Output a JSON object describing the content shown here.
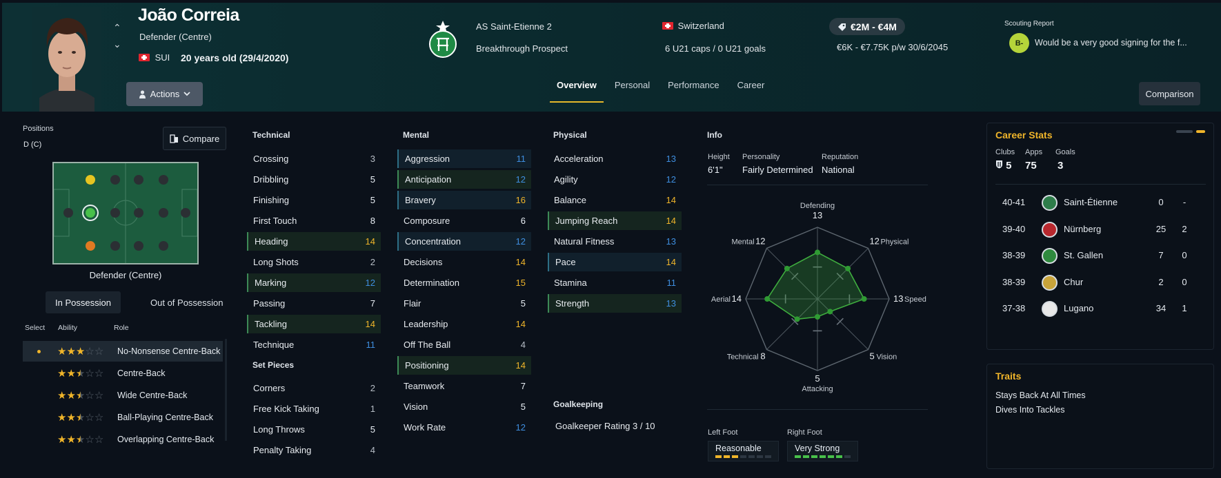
{
  "header": {
    "name": "João Correia",
    "position": "Defender (Centre)",
    "nationality_code": "SUI",
    "age": "20 years old (29/4/2020)",
    "actions_label": "Actions",
    "club": "AS Saint-Etienne 2",
    "status": "Breakthrough Prospect",
    "country": "Switzerland",
    "caps": "6 U21 caps / 0 U21 goals",
    "value": "€2M - €4M",
    "wage_contract": "€6K - €7.75K p/w 30/6/2045",
    "scouting_title": "Scouting Report",
    "scouting_grade": "B-",
    "scouting_text": "Would be a very good signing for the f...",
    "tabs": [
      "Overview",
      "Personal",
      "Performance",
      "Career"
    ],
    "comparison_label": "Comparison"
  },
  "positions": {
    "title": "Positions",
    "current": "D (C)",
    "compare_label": "Compare",
    "pitch_caption": "Defender (Centre)",
    "tab_in": "In Possession",
    "tab_out": "Out of Possession",
    "col_select": "Select",
    "col_ability": "Ability",
    "col_role": "Role",
    "roles": [
      {
        "stars": 3,
        "name": "No-Nonsense Centre-Back"
      },
      {
        "stars": 2.5,
        "name": "Centre-Back"
      },
      {
        "stars": 2.5,
        "name": "Wide Centre-Back"
      },
      {
        "stars": 2.5,
        "name": "Ball-Playing Centre-Back"
      },
      {
        "stars": 2.5,
        "name": "Overlapping Centre-Back"
      }
    ]
  },
  "technical": {
    "title": "Technical",
    "items": [
      {
        "n": "Crossing",
        "v": "3"
      },
      {
        "n": "Dribbling",
        "v": "5"
      },
      {
        "n": "Finishing",
        "v": "5"
      },
      {
        "n": "First Touch",
        "v": "8"
      },
      {
        "n": "Heading",
        "v": "14"
      },
      {
        "n": "Long Shots",
        "v": "2"
      },
      {
        "n": "Marking",
        "v": "12"
      },
      {
        "n": "Passing",
        "v": "7"
      },
      {
        "n": "Tackling",
        "v": "14"
      },
      {
        "n": "Technique",
        "v": "11"
      }
    ]
  },
  "setpieces": {
    "title": "Set Pieces",
    "items": [
      {
        "n": "Corners",
        "v": "2"
      },
      {
        "n": "Free Kick Taking",
        "v": "1"
      },
      {
        "n": "Long Throws",
        "v": "5"
      },
      {
        "n": "Penalty Taking",
        "v": "4"
      }
    ]
  },
  "mental": {
    "title": "Mental",
    "items": [
      {
        "n": "Aggression",
        "v": "11"
      },
      {
        "n": "Anticipation",
        "v": "12"
      },
      {
        "n": "Bravery",
        "v": "16"
      },
      {
        "n": "Composure",
        "v": "6"
      },
      {
        "n": "Concentration",
        "v": "12"
      },
      {
        "n": "Decisions",
        "v": "14"
      },
      {
        "n": "Determination",
        "v": "15"
      },
      {
        "n": "Flair",
        "v": "5"
      },
      {
        "n": "Leadership",
        "v": "14"
      },
      {
        "n": "Off The Ball",
        "v": "4"
      },
      {
        "n": "Positioning",
        "v": "14"
      },
      {
        "n": "Teamwork",
        "v": "7"
      },
      {
        "n": "Vision",
        "v": "5"
      },
      {
        "n": "Work Rate",
        "v": "12"
      }
    ]
  },
  "physical": {
    "title": "Physical",
    "items": [
      {
        "n": "Acceleration",
        "v": "13"
      },
      {
        "n": "Agility",
        "v": "12"
      },
      {
        "n": "Balance",
        "v": "14"
      },
      {
        "n": "Jumping Reach",
        "v": "14"
      },
      {
        "n": "Natural Fitness",
        "v": "13"
      },
      {
        "n": "Pace",
        "v": "14"
      },
      {
        "n": "Stamina",
        "v": "11"
      },
      {
        "n": "Strength",
        "v": "13"
      }
    ]
  },
  "goalkeeping": {
    "title": "Goalkeeping",
    "rating": "Goalkeeper Rating 3 / 10"
  },
  "info": {
    "title": "Info",
    "height_label": "Height",
    "height": "6'1\"",
    "personality_label": "Personality",
    "personality": "Fairly Determined",
    "reputation_label": "Reputation",
    "reputation": "National",
    "radar": [
      {
        "label": "Defending",
        "value": "13"
      },
      {
        "label": "Physical",
        "value": "12"
      },
      {
        "label": "Speed",
        "value": "13"
      },
      {
        "label": "Vision",
        "value": "5"
      },
      {
        "label": "Attacking",
        "value": "5"
      },
      {
        "label": "Technical",
        "value": "8"
      },
      {
        "label": "Aerial",
        "value": "14"
      },
      {
        "label": "Mental",
        "value": "12"
      }
    ],
    "left_foot_label": "Left Foot",
    "left_foot": "Reasonable",
    "left_foot_level": 3,
    "right_foot_label": "Right Foot",
    "right_foot": "Very Strong",
    "right_foot_level": 6
  },
  "career": {
    "title": "Career Stats",
    "clubs_label": "Clubs",
    "clubs": "5",
    "apps_label": "Apps",
    "apps": "75",
    "goals_label": "Goals",
    "goals": "3",
    "rows": [
      {
        "season": "40-41",
        "club": "Saint-Étienne",
        "apps": "0",
        "goals": "-",
        "color": "#2e7d4a"
      },
      {
        "season": "39-40",
        "club": "Nürnberg",
        "apps": "25",
        "goals": "2",
        "color": "#b8282e"
      },
      {
        "season": "38-39",
        "club": "St. Gallen",
        "apps": "7",
        "goals": "0",
        "color": "#2f8a3e"
      },
      {
        "season": "38-39",
        "club": "Chur",
        "apps": "2",
        "goals": "0",
        "color": "#c9a43a"
      },
      {
        "season": "37-38",
        "club": "Lugano",
        "apps": "34",
        "goals": "1",
        "color": "#e8e8e8"
      }
    ]
  },
  "traits": {
    "title": "Traits",
    "items": [
      "Stays Back At All Times",
      "Dives Into Tackles"
    ]
  }
}
